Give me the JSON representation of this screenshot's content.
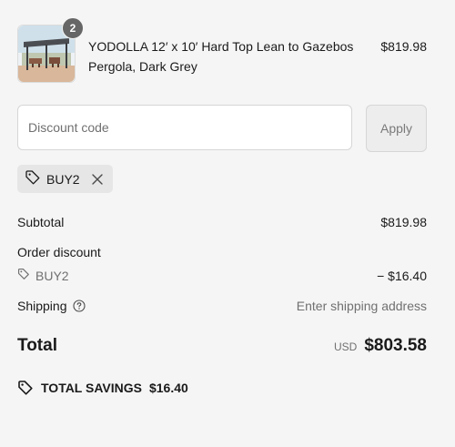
{
  "product": {
    "quantity": "2",
    "name": "YODOLLA 12′ x 10′ Hard Top Lean to Gazebos Pergola, Dark Grey",
    "price": "$819.98",
    "thumbnail_icon": "gazebo-product-image"
  },
  "discount": {
    "placeholder": "Discount code",
    "value": "",
    "apply_label": "Apply",
    "applied_code": "BUY2"
  },
  "summary": {
    "subtotal_label": "Subtotal",
    "subtotal_value": "$819.98",
    "order_discount_label": "Order discount",
    "discount_code": "BUY2",
    "discount_value": "− $16.40",
    "shipping_label": "Shipping",
    "shipping_value": "Enter shipping address",
    "total_label": "Total",
    "currency": "USD",
    "total_value": "$803.58"
  },
  "savings": {
    "label": "TOTAL SAVINGS",
    "value": "$16.40"
  },
  "colors": {
    "background": "#f5f5f5",
    "text": "#1a1a1a",
    "muted": "#707070",
    "chip": "#e6e6e6",
    "badge": "#666666"
  }
}
